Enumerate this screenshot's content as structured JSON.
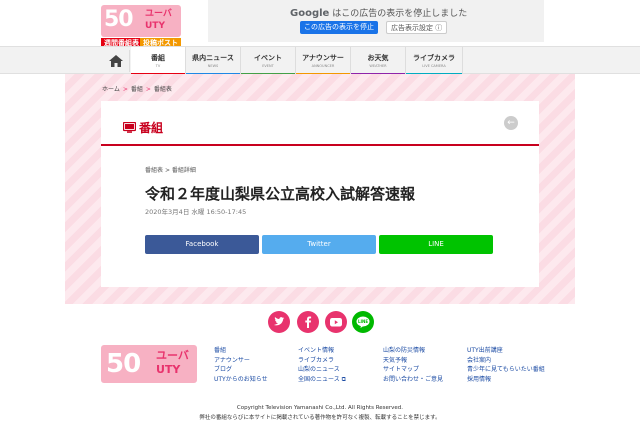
{
  "header": {
    "logo_number": "50",
    "logo_text_1": "ユーバ",
    "logo_text_2": "UTY",
    "pill_schedule": "週間番組表",
    "pill_post": "投稿ポスト"
  },
  "ad": {
    "google": "Google",
    "message": "はこの広告の表示を停止しました",
    "stop_button": "この広告の表示を停止",
    "settings_button": "広告表示設定 ⓘ"
  },
  "nav": {
    "items": [
      {
        "jp": "番組",
        "en": "TV",
        "color": "#e60012"
      },
      {
        "jp": "県内ニュース",
        "en": "NEWS",
        "color": "#1e88e5"
      },
      {
        "jp": "イベント",
        "en": "EVENT",
        "color": "#43a047"
      },
      {
        "jp": "アナウンサー",
        "en": "ANNOUNCER",
        "color": "#f39800"
      },
      {
        "jp": "お天気",
        "en": "WEATHER",
        "color": "#8e24aa"
      },
      {
        "jp": "ライブカメラ",
        "en": "LIVE CAMERA",
        "color": "#00acc1"
      }
    ]
  },
  "breadcrumb": {
    "home": "ホーム",
    "sep": ">",
    "item1": "番組",
    "item2": "番組表"
  },
  "card": {
    "title": "番組",
    "sub_crumb_1": "番組表",
    "sub_crumb_sep": ">",
    "sub_crumb_2": "番組詳細",
    "program_title": "令和２年度山梨県公立高校入試解答速報",
    "program_date": "2020年3月4日 水曜 16:50-17:45"
  },
  "share": {
    "facebook": "Facebook",
    "twitter": "Twitter",
    "line": "LINE"
  },
  "social": {
    "line_label": "LINE"
  },
  "footer": {
    "col1": [
      "番組",
      "アナウンサー",
      "ブログ",
      "UTYからのお知らせ"
    ],
    "col2": [
      "イベント情報",
      "ライブカメラ",
      "山梨のニュース",
      "全国のニュース ⧉"
    ],
    "col3": [
      "山梨の防災情報",
      "天気予報",
      "サイトマップ",
      "お問い合わせ・ご意見"
    ],
    "col4": [
      "UTY出前講座",
      "会社案内",
      "青少年に見てもらいたい番組",
      "採用情報"
    ],
    "copyright": "Copyright Television Yamanashi Co.,Ltd. All Rights Reserved.",
    "notice": "弊社の番組ならびに本サイトに掲載されている著作物を許可なく複製、転載することを禁じます。"
  }
}
